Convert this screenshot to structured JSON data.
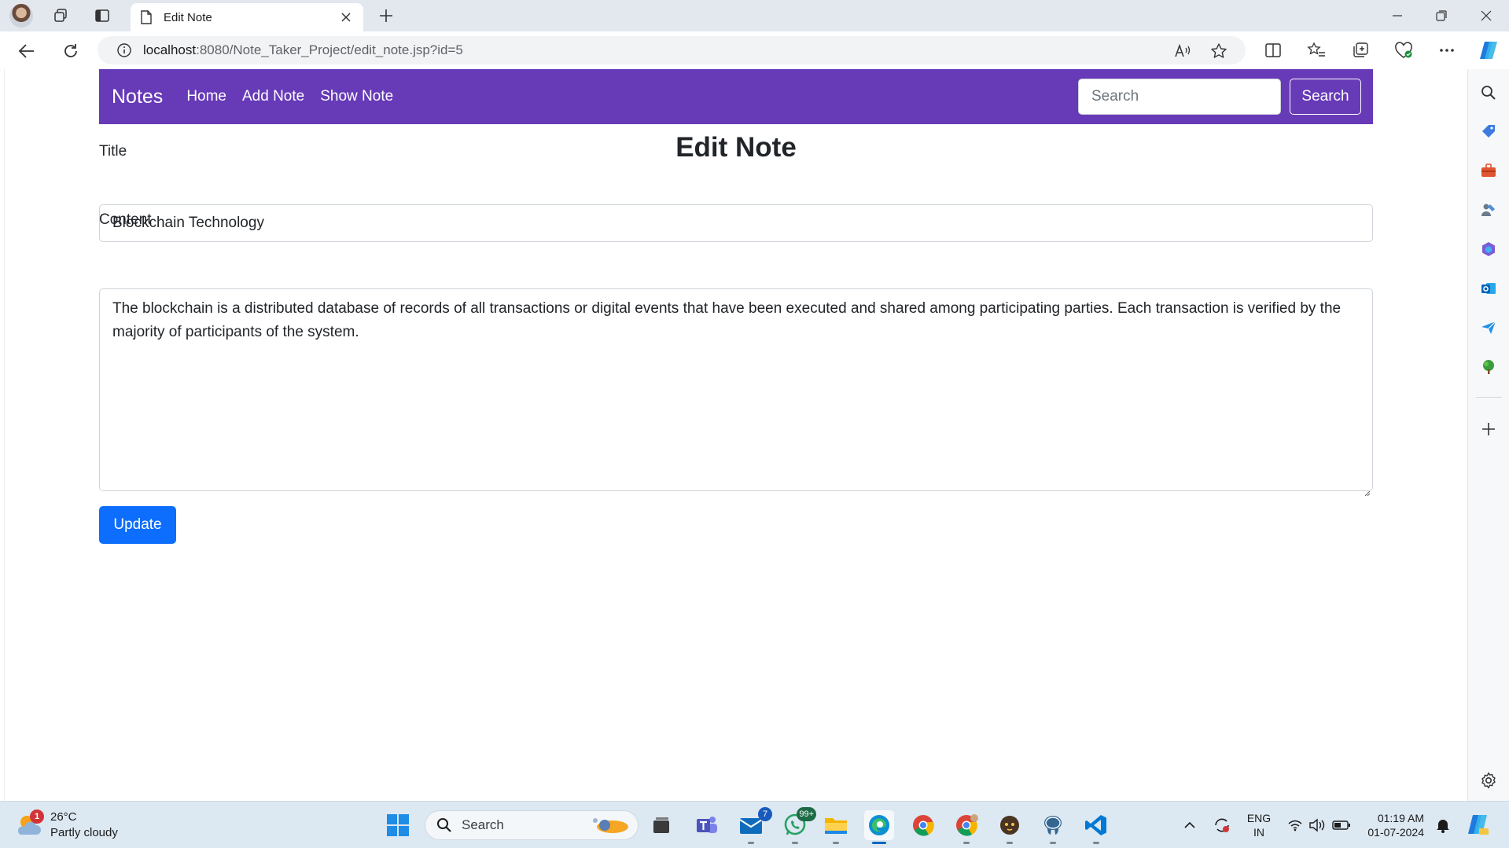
{
  "browser": {
    "tab_title": "Edit Note",
    "url_host": "localhost",
    "url_path": ":8080/Note_Taker_Project/edit_note.jsp?id=5"
  },
  "page": {
    "navbar": {
      "brand": "Notes",
      "links": [
        "Home",
        "Add Note",
        "Show Note"
      ],
      "search_placeholder": "Search",
      "search_button": "Search",
      "color": "#673ab7"
    },
    "heading": "Edit Note",
    "form": {
      "title_label": "Title",
      "title_value": "Blockchain Technology",
      "content_label": "Content",
      "content_value": "The blockchain is a distributed database of records of all transactions or digital events that have been executed and shared among participating parties. Each transaction is verified by the majority of participants of the system.",
      "submit_label": "Update",
      "submit_color": "#0d6efd"
    }
  },
  "taskbar": {
    "weather": {
      "temperature": "26°C",
      "condition": "Partly cloudy",
      "alert_count": "1"
    },
    "search_label": "Search",
    "badges": {
      "mail": "7",
      "whatsapp": "99+"
    },
    "language": {
      "line1": "ENG",
      "line2": "IN"
    },
    "clock": {
      "time": "01:19 AM",
      "date": "01-07-2024"
    }
  }
}
